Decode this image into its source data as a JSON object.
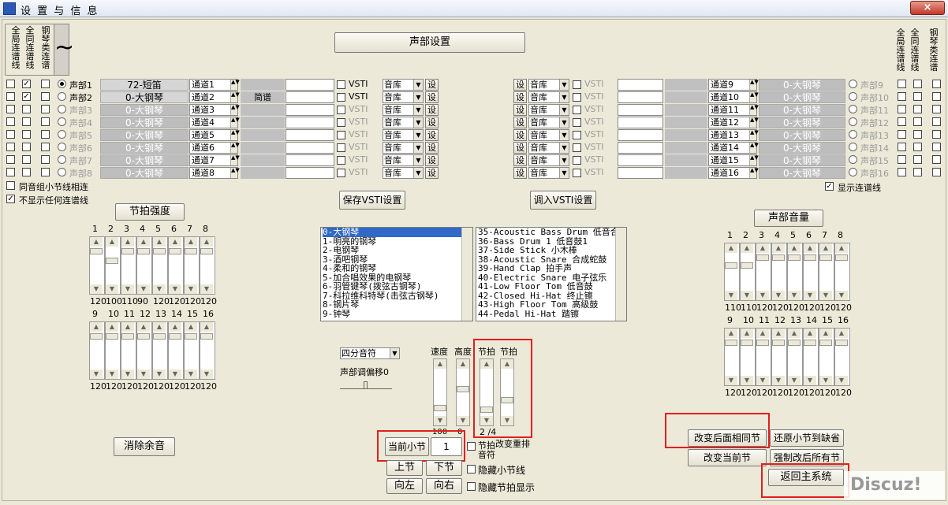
{
  "window": {
    "title": "设 置 与 信 息",
    "close": "×"
  },
  "left_vert_labels": [
    "全局连谱线",
    "全同连谱线",
    "钢琴类连谱"
  ],
  "right_vert_labels": [
    "全局连谱线",
    "全同连谱线",
    "钢琴类连谱"
  ],
  "voice_settings_button": "声部设置",
  "left_voices": [
    {
      "label": "声部1",
      "instrument": "72-短笛",
      "channel": "通道1",
      "mid": "",
      "vsti": "VSTI",
      "lib": "音库",
      "set": "设",
      "enabled": true,
      "radio": true,
      "cb1": false,
      "cb2": true,
      "cb3": false
    },
    {
      "label": "声部2",
      "instrument": "0-大钢琴",
      "channel": "通道2",
      "mid": "简谱",
      "vsti": "VSTI",
      "lib": "音库",
      "set": "设",
      "enabled": true,
      "radio": false,
      "cb1": false,
      "cb2": true,
      "cb3": false
    },
    {
      "label": "声部3",
      "instrument": "0-大钢琴",
      "channel": "通道3",
      "mid": "",
      "vsti": "VSTI",
      "lib": "音库",
      "set": "设",
      "enabled": false,
      "radio": false,
      "cb1": false,
      "cb2": false,
      "cb3": false
    },
    {
      "label": "声部4",
      "instrument": "0-大钢琴",
      "channel": "通道4",
      "mid": "",
      "vsti": "VSTI",
      "lib": "音库",
      "set": "设",
      "enabled": false,
      "radio": false,
      "cb1": false,
      "cb2": false,
      "cb3": false
    },
    {
      "label": "声部5",
      "instrument": "0-大钢琴",
      "channel": "通道5",
      "mid": "",
      "vsti": "VSTI",
      "lib": "音库",
      "set": "设",
      "enabled": false,
      "radio": false,
      "cb1": false,
      "cb2": false,
      "cb3": false
    },
    {
      "label": "声部6",
      "instrument": "0-大钢琴",
      "channel": "通道6",
      "mid": "",
      "vsti": "VSTI",
      "lib": "音库",
      "set": "设",
      "enabled": false,
      "radio": false,
      "cb1": false,
      "cb2": false,
      "cb3": false
    },
    {
      "label": "声部7",
      "instrument": "0-大钢琴",
      "channel": "通道7",
      "mid": "",
      "vsti": "VSTI",
      "lib": "音库",
      "set": "设",
      "enabled": false,
      "radio": false,
      "cb1": false,
      "cb2": false,
      "cb3": false
    },
    {
      "label": "声部8",
      "instrument": "0-大钢琴",
      "channel": "通道8",
      "mid": "",
      "vsti": "VSTI",
      "lib": "音库",
      "set": "设",
      "enabled": false,
      "radio": false,
      "cb1": false,
      "cb2": false,
      "cb3": false
    }
  ],
  "right_voices": [
    {
      "label": "声部9",
      "instrument": "0-大钢琴",
      "channel": "通道9",
      "vsti": "VSTI",
      "lib": "音库",
      "set": "设"
    },
    {
      "label": "声部10",
      "instrument": "0-大钢琴",
      "channel": "通道10",
      "vsti": "VSTI",
      "lib": "音库",
      "set": "设"
    },
    {
      "label": "声部11",
      "instrument": "0-大钢琴",
      "channel": "通道11",
      "vsti": "VSTI",
      "lib": "音库",
      "set": "设"
    },
    {
      "label": "声部12",
      "instrument": "0-大钢琴",
      "channel": "通道12",
      "vsti": "VSTI",
      "lib": "音库",
      "set": "设"
    },
    {
      "label": "声部13",
      "instrument": "0-大钢琴",
      "channel": "通道13",
      "vsti": "VSTI",
      "lib": "音库",
      "set": "设"
    },
    {
      "label": "声部14",
      "instrument": "0-大钢琴",
      "channel": "通道14",
      "vsti": "VSTI",
      "lib": "音库",
      "set": "设"
    },
    {
      "label": "声部15",
      "instrument": "0-大钢琴",
      "channel": "通道15",
      "vsti": "VSTI",
      "lib": "音库",
      "set": "设"
    },
    {
      "label": "声部16",
      "instrument": "0-大钢琴",
      "channel": "通道16",
      "vsti": "VSTI",
      "lib": "音库",
      "set": "设"
    }
  ],
  "options": {
    "same_group_bar": "同音组小节线相连",
    "hide_ties": "不显示任何连谱线",
    "show_ties": "显示连谱线"
  },
  "save_vsti": "保存VSTI设置",
  "load_vsti": "调入VSTI设置",
  "beat_strength": {
    "title": "节拍强度",
    "top_nums": [
      "1",
      "2",
      "3",
      "4",
      "5",
      "6",
      "7",
      "8"
    ],
    "top_vals": [
      "120",
      "100",
      "110",
      "90",
      "120",
      "120",
      "120",
      "120"
    ],
    "bot_nums": [
      "9",
      "10",
      "11",
      "12",
      "13",
      "14",
      "15",
      "16"
    ],
    "bot_vals": [
      "120",
      "120",
      "120",
      "120",
      "120",
      "120",
      "120",
      "120"
    ]
  },
  "voice_volume": {
    "title": "声部音量",
    "top_nums": [
      "1",
      "2",
      "3",
      "4",
      "5",
      "6",
      "7",
      "8"
    ],
    "top_vals": [
      "110",
      "110",
      "120",
      "120",
      "120",
      "120",
      "120",
      "120"
    ],
    "bot_nums": [
      "9",
      "10",
      "11",
      "12",
      "13",
      "14",
      "15",
      "16"
    ],
    "bot_vals": [
      "120",
      "120",
      "120",
      "120",
      "120",
      "120",
      "120",
      "120"
    ]
  },
  "instrument_list": [
    "0-大钢琴",
    "1-明亮的钢琴",
    "2-电钢琴",
    "3-酒吧钢琴",
    "4-柔和的钢琴",
    "5-加合唱效果的电钢琴",
    "6-羽管键琴(拨弦古钢琴)",
    "7-科拉维科特琴(击弦古钢琴)",
    "8-钢片琴",
    "9-钟琴"
  ],
  "drum_list": [
    "35-Acoustic Bass Drum  低音合",
    "36-Bass Drum 1 低音鼓1",
    "37-Side Stick 小木棒",
    "38-Acoustic Snare 合成蛇鼓",
    "39-Hand Clap 拍手声",
    "40-Electric Snare 电子弦乐",
    "41-Low Floor Tom 低音鼓",
    "42-Closed Hi-Hat 终止镲",
    "43-High Floor Tom 高级鼓",
    "44-Pedal Hi-Hat 踏镲"
  ],
  "note_select": "四分音符",
  "voice_transpose": "声部调偏移0",
  "sliders": {
    "speed": "速度",
    "height": "高度",
    "beat1": "节拍",
    "beat2": "节拍",
    "speed_val": "100",
    "height_val": "0",
    "beat_val": "2 /4"
  },
  "bar_controls": {
    "current_bar": "当前小节",
    "bar_value": "1",
    "change_meter": "改变重排",
    "hidden_text": "节拍",
    "meter_text": "音符",
    "prev": "上节",
    "next": "下节",
    "left": "向左",
    "right": "向右",
    "hide_bar": "隐藏小节线",
    "hide_beat": "隐藏节拍显示"
  },
  "clear_sound": "消除余音",
  "right_buttons": {
    "change_after": "改变后面相同节",
    "restore": "还原小节到缺省",
    "change_current": "改变当前节",
    "force_all": "强制改后所有节",
    "return_main": "返回主系统"
  },
  "watermark": "Discuz!"
}
